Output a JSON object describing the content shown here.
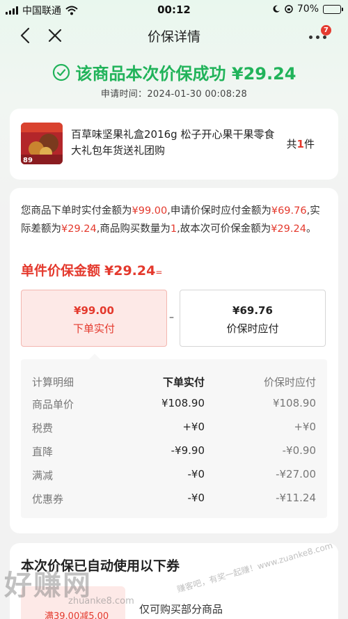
{
  "status_bar": {
    "carrier": "中国联通",
    "time": "00:12",
    "battery": "70%",
    "battery_level": 0.7
  },
  "nav": {
    "title": "价保详情",
    "badge": "7"
  },
  "success": {
    "message": "该商品本次价保成功 ¥29.24",
    "apply_time": "申请时间：2024-01-30 00:08:28"
  },
  "product": {
    "name": "百草味坚果礼盒2016g 松子开心果干果零食大礼包年货送礼团购",
    "count_prefix": "共",
    "count": "1",
    "count_suffix": "件"
  },
  "detail": {
    "desc_parts": [
      {
        "text": "您商品下单时实付金额为",
        "red": false
      },
      {
        "text": "¥99.00",
        "red": true
      },
      {
        "text": ",申请价保时应付金额为",
        "red": false
      },
      {
        "text": "¥69.76",
        "red": true
      },
      {
        "text": ",实际差额为",
        "red": false
      },
      {
        "text": "¥29.24",
        "red": true
      },
      {
        "text": ",商品购买数量为",
        "red": false
      },
      {
        "text": "1",
        "red": true
      },
      {
        "text": ",故本次可价保金额为",
        "red": false
      },
      {
        "text": "¥29.24",
        "red": true
      },
      {
        "text": "。",
        "red": false
      }
    ],
    "unit_label": "单件价保金额",
    "unit_value": "¥29.24",
    "unit_eq": "=",
    "paid_amount": "¥99.00",
    "paid_label": "下单实付",
    "dash": "–",
    "protect_amount": "¥69.76",
    "protect_label": "价保时应付"
  },
  "calc": {
    "headers": [
      "计算明细",
      "下单实付",
      "价保时应付"
    ],
    "rows": [
      [
        "商品单价",
        "¥108.90",
        "¥108.90"
      ],
      [
        "税费",
        "+¥0",
        "+¥0"
      ],
      [
        "直降",
        "-¥9.90",
        "-¥0.90"
      ],
      [
        "满减",
        "-¥0",
        "-¥27.00"
      ],
      [
        "优惠券",
        "-¥0",
        "-¥11.24"
      ]
    ]
  },
  "coupon": {
    "title": "本次价保已自动使用以下券",
    "coupon_text": "满39.00减5.00",
    "desc": "仅可购买部分商品"
  },
  "watermark": {
    "main": "好赚网",
    "url": "zhuanke8.com",
    "right": "赚客吧，有奖一起赚！www.zuanke8.com"
  },
  "colors": {
    "success_green": "#21b35a",
    "accent_red": "#e4392d"
  }
}
